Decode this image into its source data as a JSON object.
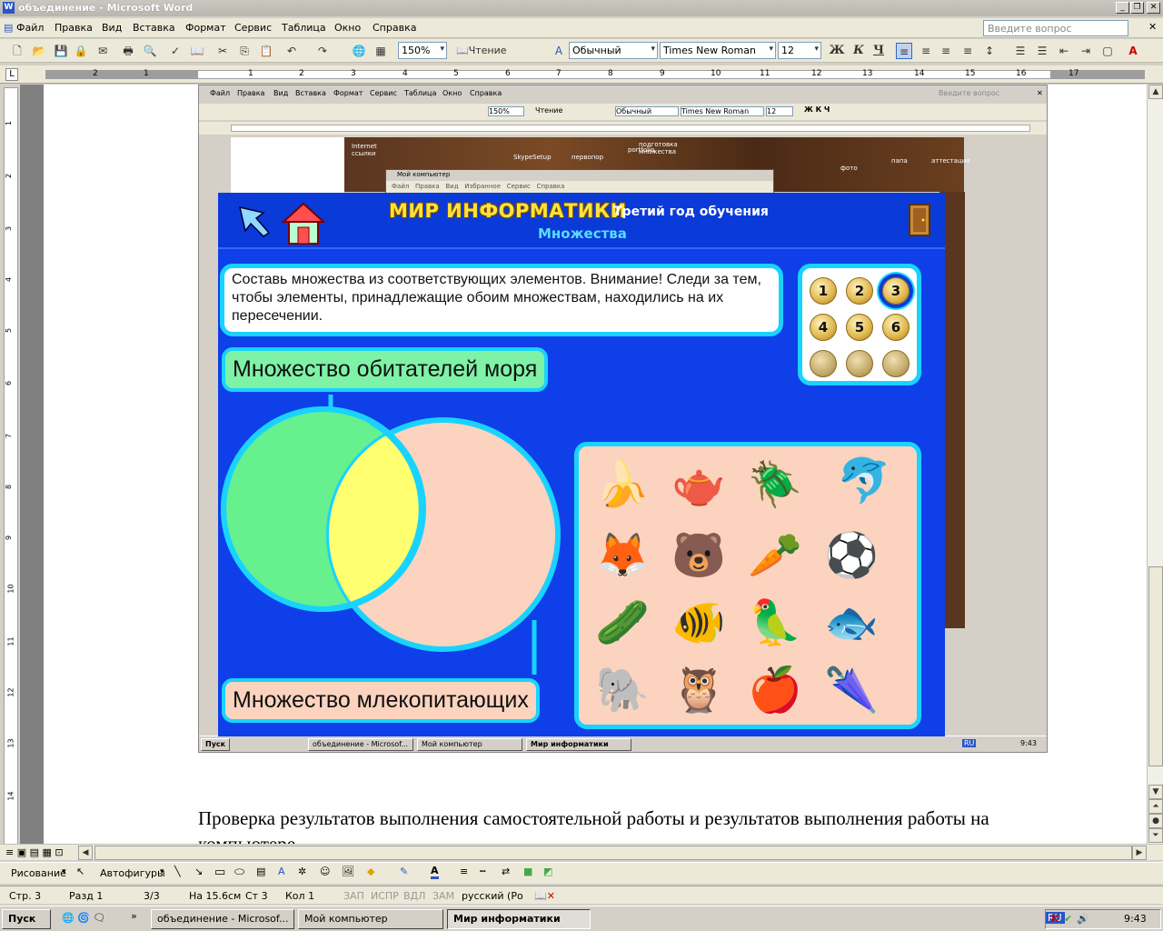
{
  "window": {
    "title": "объединение - Microsoft Word"
  },
  "menu": [
    "Файл",
    "Правка",
    "Вид",
    "Вставка",
    "Формат",
    "Сервис",
    "Таблица",
    "Окно",
    "Справка"
  ],
  "ask_placeholder": "Введите вопрос",
  "toolbar": {
    "zoom": "150%",
    "reading": "Чтение",
    "style": "Обычный",
    "font": "Times New Roman",
    "size": "12",
    "bold": "Ж",
    "italic": "К",
    "underline": "Ч"
  },
  "ruler_numbers": [
    "2",
    "1",
    "1",
    "1",
    "2",
    "3",
    "4",
    "5",
    "6",
    "7",
    "8",
    "9",
    "10",
    "11",
    "12",
    "13",
    "14",
    "15",
    "16",
    "17"
  ],
  "vruler_numbers": [
    "1",
    "2",
    "3",
    "4",
    "5",
    "6",
    "7",
    "8",
    "9",
    "10",
    "11",
    "12",
    "13",
    "14"
  ],
  "inner": {
    "menu": [
      "Файл",
      "Правка",
      "Вид",
      "Вставка",
      "Формат",
      "Сервис",
      "Таблица",
      "Окно",
      "Справка"
    ],
    "ask": "Введите вопрос",
    "zoom": "150%",
    "reading": "Чтение",
    "style": "Обычный",
    "font": "Times New Roman",
    "size": "12",
    "mycomp_title": "Мой компьютер",
    "mycomp_menu": [
      "Файл",
      "Правка",
      "Вид",
      "Избранное",
      "Сервис",
      "Справка"
    ],
    "desktop_icons": [
      "Internet ссылки",
      "SkypeSetup",
      "первопор",
      "portfolio",
      "подготовка множества",
      "фото",
      "папа",
      "аттестация"
    ],
    "taskbar": {
      "start": "Пуск",
      "buttons": [
        "объединение - Microsof...",
        "Мой компьютер",
        "Мир информатики"
      ],
      "lang": "RU",
      "time": "9:43"
    }
  },
  "app": {
    "title": "МИР ИНФОРМАТИКИ",
    "subtitle": "Третий год обучения",
    "topic": "Множества",
    "task": "Составь множества из соответствующих элементов. Внимание! Следи за тем, чтобы элементы, принадлежащие обоим множествам, находились на их пересечении.",
    "numbers": [
      "1",
      "2",
      "3",
      "4",
      "5",
      "6"
    ],
    "active_number": "3",
    "set1_label": "Множество обитателей моря",
    "set2_label": "Множество млекопитающих",
    "items": [
      "banana",
      "teapot",
      "beetle",
      "dolphin",
      "fox",
      "bear",
      "carrot",
      "ball",
      "cucumber",
      "goldfish",
      "parrot",
      "fish",
      "elephant",
      "owl",
      "apple",
      "umbrella"
    ],
    "colors": {
      "bg": "#0e3fe8",
      "border": "#19d3ff",
      "set1": "#66f08e",
      "set2": "#fbd3be",
      "intersection": "#ffff70"
    }
  },
  "doc_paragraph": "Проверка результатов выполнения самостоятельной работы и результатов выполнения работы на компьютере.",
  "drawbar": {
    "draw": "Рисование",
    "autoshapes": "Автофигуры"
  },
  "status": {
    "page": "Стр. 3",
    "section": "Разд 1",
    "pages": "3/3",
    "at": "На 15.6см",
    "line": "Ст 3",
    "col": "Кол 1",
    "rec": "ЗАП",
    "trk": "ИСПР",
    "ext": "ВДЛ",
    "ovr": "ЗАМ",
    "lang": "русский (Ро"
  },
  "taskbar": {
    "start": "Пуск",
    "buttons": [
      "объединение - Microsof...",
      "Мой компьютер",
      "Мир информатики"
    ],
    "lang": "RU",
    "time": "9:43"
  }
}
